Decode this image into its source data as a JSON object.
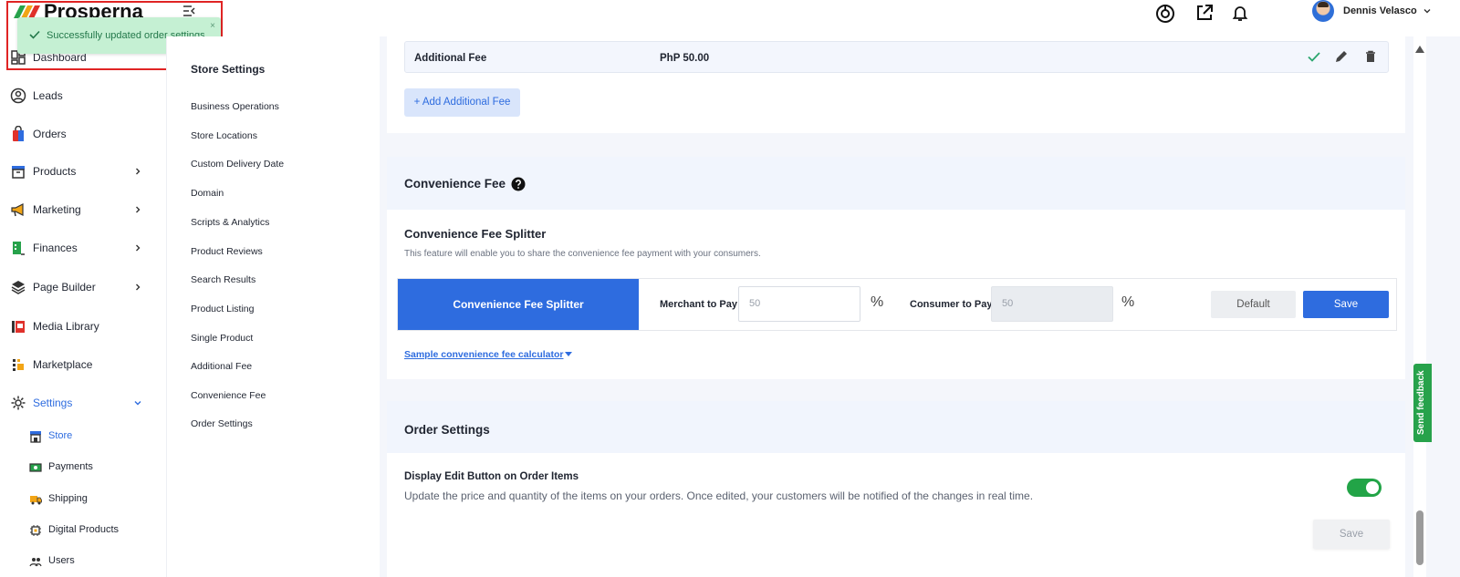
{
  "brand": {
    "name": "Prosperna"
  },
  "user": {
    "name": "Dennis Velasco"
  },
  "toast": {
    "message": "Successfully updated order settings.",
    "close": "×"
  },
  "sidebar": {
    "items": [
      {
        "label": "Dashboard",
        "icon": "dashboard-icon"
      },
      {
        "label": "Leads",
        "icon": "leads-icon"
      },
      {
        "label": "Orders",
        "icon": "orders-icon"
      },
      {
        "label": "Products",
        "icon": "products-icon"
      },
      {
        "label": "Marketing",
        "icon": "megaphone-icon"
      },
      {
        "label": "Finances",
        "icon": "finances-icon"
      },
      {
        "label": "Page Builder",
        "icon": "layers-icon"
      },
      {
        "label": "Media Library",
        "icon": "media-library-icon"
      },
      {
        "label": "Marketplace",
        "icon": "marketplace-icon"
      },
      {
        "label": "Settings",
        "icon": "gear-icon"
      }
    ],
    "sub_items": [
      {
        "label": "Store",
        "icon": "store-icon"
      },
      {
        "label": "Payments",
        "icon": "payments-icon"
      },
      {
        "label": "Shipping",
        "icon": "truck-icon"
      },
      {
        "label": "Digital Products",
        "icon": "chip-icon"
      },
      {
        "label": "Users",
        "icon": "users-icon"
      }
    ]
  },
  "store_menu": {
    "title": "Store Settings",
    "links": [
      "Business Operations",
      "Store Locations",
      "Custom Delivery Date",
      "Domain",
      "Scripts & Analytics",
      "Product Reviews",
      "Search Results",
      "Product Listing",
      "Single Product",
      "Additional Fee",
      "Convenience Fee",
      "Order Settings"
    ]
  },
  "additional_fee": {
    "name": "Additional Fee",
    "amount": "PhP 50.00",
    "add_button": "+ Add Additional Fee"
  },
  "convenience_fee": {
    "section_title": "Convenience Fee",
    "subtitle": "Convenience Fee Splitter",
    "description": "This feature will enable you to share the convenience fee payment with your consumers.",
    "tab_label": "Convenience Fee Splitter",
    "merchant_label": "Merchant to Pay",
    "merchant_value": "50",
    "consumer_label": "Consumer to Pay",
    "consumer_value": "50",
    "percent_symbol": "%",
    "default_button": "Default",
    "save_button": "Save",
    "calculator_link": "Sample convenience fee calculator"
  },
  "order_settings": {
    "section_title": "Order Settings",
    "option_title": "Display Edit Button on Order Items",
    "option_desc": "Update the price and quantity of the items on your orders. Once edited, your customers will be notified of the changes in real time.",
    "toggle_on": true,
    "save_button": "Save"
  },
  "feedback": {
    "label": "Send feedback"
  },
  "colors": {
    "accent": "#2e6cdf",
    "success": "#22a447",
    "toast_bg": "#c5f0d3",
    "highlight": "#e02424"
  }
}
